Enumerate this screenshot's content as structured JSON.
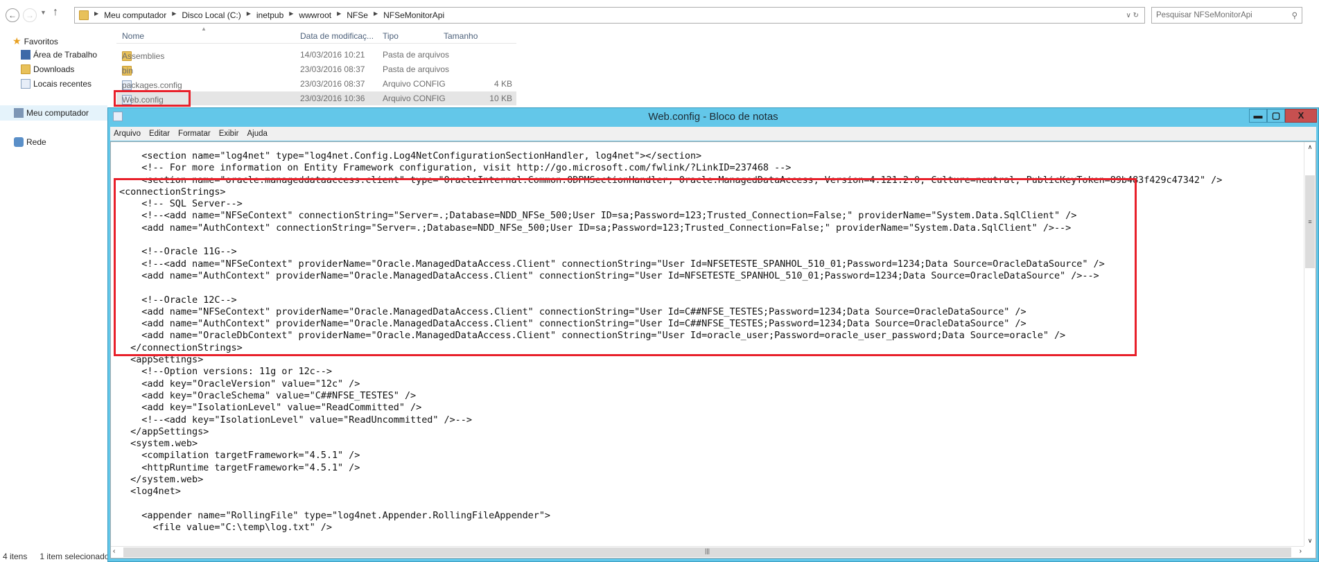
{
  "explorer": {
    "breadcrumb": [
      "Meu computador",
      "Disco Local (C:)",
      "inetpub",
      "wwwroot",
      "NFSe",
      "NFSeMonitorApi"
    ],
    "search_placeholder": "Pesquisar NFSeMonitorApi",
    "sidebar": {
      "favorites": "Favoritos",
      "items": [
        "Área de Trabalho",
        "Downloads",
        "Locais recentes"
      ],
      "computer": "Meu computador",
      "network": "Rede"
    },
    "columns": [
      "Nome",
      "Data de modificaç...",
      "Tipo",
      "Tamanho"
    ],
    "files": [
      {
        "name": "Assemblies",
        "date": "14/03/2016 10:21",
        "type": "Pasta de arquivos",
        "size": "",
        "icon": "folder-icon"
      },
      {
        "name": "bin",
        "date": "23/03/2016 08:37",
        "type": "Pasta de arquivos",
        "size": "",
        "icon": "folder-icon"
      },
      {
        "name": "packages.config",
        "date": "23/03/2016 08:37",
        "type": "Arquivo CONFIG",
        "size": "4 KB",
        "icon": "config-file-icon"
      },
      {
        "name": "Web.config",
        "date": "23/03/2016 10:36",
        "type": "Arquivo CONFIG",
        "size": "10 KB",
        "icon": "config-file-icon",
        "selected": true
      }
    ],
    "status": {
      "count": "4 itens",
      "selected": "1 item selecionado"
    }
  },
  "notepad": {
    "title": "Web.config - Bloco de notas",
    "menu": [
      "Arquivo",
      "Editar",
      "Formatar",
      "Exibir",
      "Ajuda"
    ],
    "lines": [
      "    <section name=\"log4net\" type=\"log4net.Config.Log4NetConfigurationSectionHandler, log4net\"></section>",
      "    <!-- For more information on Entity Framework configuration, visit http://go.microsoft.com/fwlink/?LinkID=237468 -->",
      "    <section name=\"oracle.manageddataaccess.client\" type=\"OracleInternal.Common.ODPMSectionHandler, Oracle.ManagedDataAccess, Version=4.121.2.0, Culture=neutral, PublicKeyToken=89b483f429c47342\" />",
      "<connectionStrings>",
      "    <!-- SQL Server-->",
      "    <!--<add name=\"NFSeContext\" connectionString=\"Server=.;Database=NDD_NFSe_500;User ID=sa;Password=123;Trusted_Connection=False;\" providerName=\"System.Data.SqlClient\" />",
      "    <add name=\"AuthContext\" connectionString=\"Server=.;Database=NDD_NFSe_500;User ID=sa;Password=123;Trusted_Connection=False;\" providerName=\"System.Data.SqlClient\" />-->",
      "",
      "    <!--Oracle 11G-->",
      "    <!--<add name=\"NFSeContext\" providerName=\"Oracle.ManagedDataAccess.Client\" connectionString=\"User Id=NFSETESTE_SPANHOL_510_01;Password=1234;Data Source=OracleDataSource\" />",
      "    <add name=\"AuthContext\" providerName=\"Oracle.ManagedDataAccess.Client\" connectionString=\"User Id=NFSETESTE_SPANHOL_510_01;Password=1234;Data Source=OracleDataSource\" />-->",
      "",
      "    <!--Oracle 12C-->",
      "    <add name=\"NFSeContext\" providerName=\"Oracle.ManagedDataAccess.Client\" connectionString=\"User Id=C##NFSE_TESTES;Password=1234;Data Source=OracleDataSource\" />",
      "    <add name=\"AuthContext\" providerName=\"Oracle.ManagedDataAccess.Client\" connectionString=\"User Id=C##NFSE_TESTES;Password=1234;Data Source=OracleDataSource\" />",
      "    <add name=\"OracleDbContext\" providerName=\"Oracle.ManagedDataAccess.Client\" connectionString=\"User Id=oracle_user;Password=oracle_user_password;Data Source=oracle\" />",
      "  </connectionStrings>",
      "  <appSettings>",
      "    <!--Option versions: 11g or 12c-->",
      "    <add key=\"OracleVersion\" value=\"12c\" />",
      "    <add key=\"OracleSchema\" value=\"C##NFSE_TESTES\" />",
      "    <add key=\"IsolationLevel\" value=\"ReadCommitted\" />",
      "    <!--<add key=\"IsolationLevel\" value=\"ReadUncommitted\" />-->",
      "  </appSettings>",
      "  <system.web>",
      "    <compilation targetFramework=\"4.5.1\" />",
      "    <httpRuntime targetFramework=\"4.5.1\" />",
      "  </system.web>",
      "  <log4net>",
      "",
      "    <appender name=\"RollingFile\" type=\"log4net.Appender.RollingFileAppender\">",
      "      <file value=\"C:\\temp\\log.txt\" />"
    ]
  },
  "colors": {
    "highlight": "#e8202a",
    "titlebar": "#63c7e9",
    "close": "#c75050"
  }
}
